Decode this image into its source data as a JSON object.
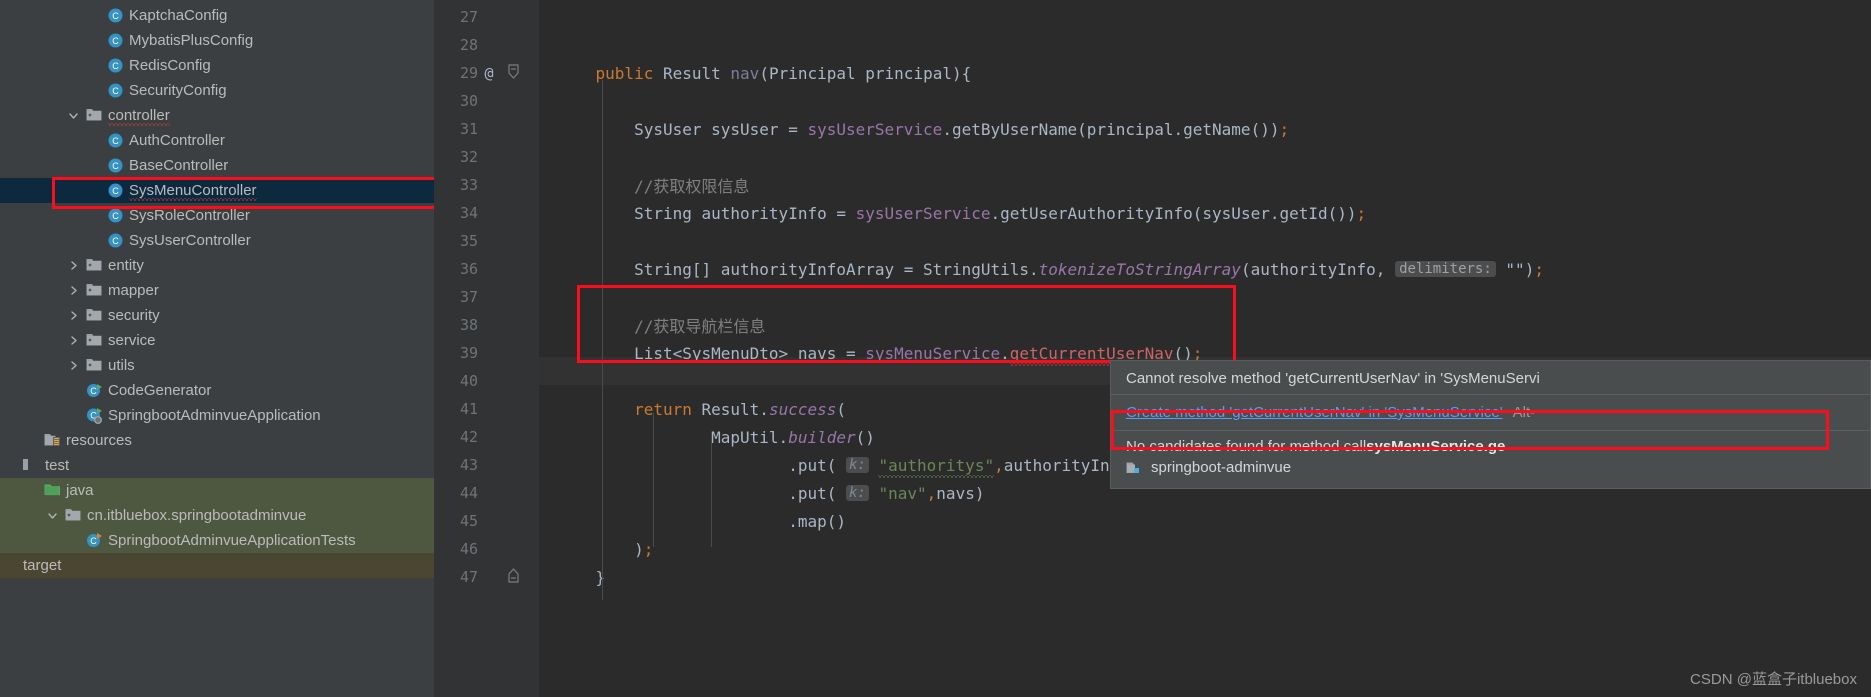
{
  "window": {
    "watermark": "CSDN @蓝盒子itbluebox"
  },
  "colors": {
    "accent_red": "#fc0d1b",
    "link_blue": "#589df6",
    "selection_blue": "#0d293e",
    "tree_bg": "#3c3f41",
    "editor_bg": "#2b2b2b",
    "gutter_bg": "#313335",
    "popup_bg": "#4a4d4e",
    "error_red": "#cc6666",
    "keyword_orange": "#cc7832",
    "string_green": "#6a8759",
    "method_purple": "#9876aa"
  },
  "project_tree": {
    "items": [
      {
        "label": "KaptchaConfig",
        "icon": "java-class-icon",
        "indent": 4,
        "arrow": "none",
        "state": "normal",
        "squiggle": false
      },
      {
        "label": "MybatisPlusConfig",
        "icon": "java-class-icon",
        "indent": 4,
        "arrow": "none",
        "state": "normal",
        "squiggle": false
      },
      {
        "label": "RedisConfig",
        "icon": "java-class-icon",
        "indent": 4,
        "arrow": "none",
        "state": "normal",
        "squiggle": false
      },
      {
        "label": "SecurityConfig",
        "icon": "java-class-icon",
        "indent": 4,
        "arrow": "none",
        "state": "normal",
        "squiggle": false
      },
      {
        "label": "controller",
        "icon": "folder-icon",
        "indent": 3,
        "arrow": "expanded",
        "state": "normal",
        "squiggle": true
      },
      {
        "label": "AuthController",
        "icon": "java-class-icon",
        "indent": 4,
        "arrow": "none",
        "state": "normal",
        "squiggle": false
      },
      {
        "label": "BaseController",
        "icon": "java-class-icon",
        "indent": 4,
        "arrow": "none",
        "state": "normal",
        "squiggle": false
      },
      {
        "label": "SysMenuController",
        "icon": "java-class-icon",
        "indent": 4,
        "arrow": "none",
        "state": "selected",
        "squiggle": true
      },
      {
        "label": "SysRoleController",
        "icon": "java-class-icon",
        "indent": 4,
        "arrow": "none",
        "state": "normal",
        "squiggle": false
      },
      {
        "label": "SysUserController",
        "icon": "java-class-icon",
        "indent": 4,
        "arrow": "none",
        "state": "normal",
        "squiggle": false
      },
      {
        "label": "entity",
        "icon": "folder-icon",
        "indent": 3,
        "arrow": "collapsed",
        "state": "normal",
        "squiggle": false
      },
      {
        "label": "mapper",
        "icon": "folder-icon",
        "indent": 3,
        "arrow": "collapsed",
        "state": "normal",
        "squiggle": false
      },
      {
        "label": "security",
        "icon": "folder-icon",
        "indent": 3,
        "arrow": "collapsed",
        "state": "normal",
        "squiggle": false
      },
      {
        "label": "service",
        "icon": "folder-icon",
        "indent": 3,
        "arrow": "collapsed",
        "state": "normal",
        "squiggle": false
      },
      {
        "label": "utils",
        "icon": "folder-icon",
        "indent": 3,
        "arrow": "collapsed",
        "state": "normal",
        "squiggle": false
      },
      {
        "label": "CodeGenerator",
        "icon": "java-runnable-class-icon",
        "indent": 3,
        "arrow": "none",
        "state": "normal",
        "squiggle": false
      },
      {
        "label": "SpringbootAdminvueApplication",
        "icon": "spring-boot-class-icon",
        "indent": 3,
        "arrow": "none",
        "state": "normal",
        "squiggle": false
      },
      {
        "label": "resources",
        "icon": "resources-folder-icon",
        "indent": 1,
        "arrow": "none",
        "state": "normal",
        "squiggle": false
      },
      {
        "label": "test",
        "icon": "module-bar-icon",
        "indent": 0,
        "arrow": "none",
        "state": "normal",
        "squiggle": false
      },
      {
        "label": "java",
        "icon": "test-source-folder-icon",
        "indent": 1,
        "arrow": "none",
        "state": "green",
        "squiggle": false
      },
      {
        "label": "cn.itbluebox.springbootadminvue",
        "icon": "folder-icon",
        "indent": 2,
        "arrow": "expanded",
        "state": "green",
        "squiggle": false
      },
      {
        "label": "SpringbootAdminvueApplicationTests",
        "icon": "java-test-class-icon",
        "indent": 3,
        "arrow": "none",
        "state": "green",
        "squiggle": false
      },
      {
        "label": "target",
        "icon": "none",
        "indent": 0,
        "arrow": "none",
        "state": "olive",
        "squiggle": false
      }
    ]
  },
  "editor": {
    "gutter": {
      "line_numbers": [
        "27",
        "28",
        "29",
        "30",
        "31",
        "32",
        "33",
        "34",
        "35",
        "36",
        "37",
        "38",
        "39",
        "40",
        "41",
        "42",
        "43",
        "44",
        "45",
        "46",
        "47"
      ],
      "annotation_at_line": "29",
      "annotation_glyph": "@",
      "fold_open_line": "29",
      "fold_close_line": "47",
      "caret_line": "40"
    },
    "lines": [
      {
        "num": "27",
        "tokens": []
      },
      {
        "num": "28",
        "tokens": []
      },
      {
        "num": "29",
        "tokens": [
          {
            "t": "    ",
            "c": "plain"
          },
          {
            "t": "public ",
            "c": "kw"
          },
          {
            "t": "Result ",
            "c": "typ"
          },
          {
            "t": "nav",
            "c": "meth"
          },
          {
            "t": "(Principal principal){",
            "c": "plain"
          }
        ]
      },
      {
        "num": "30",
        "tokens": []
      },
      {
        "num": "31",
        "tokens": [
          {
            "t": "        SysUser sysUser = ",
            "c": "plain"
          },
          {
            "t": "sysUserService",
            "c": "methi"
          },
          {
            "t": ".getByUserName(principal.getName())",
            "c": "plain"
          },
          {
            "t": ";",
            "c": "semi"
          }
        ]
      },
      {
        "num": "32",
        "tokens": []
      },
      {
        "num": "33",
        "tokens": [
          {
            "t": "        //获取权限信息",
            "c": "cmt"
          }
        ]
      },
      {
        "num": "34",
        "tokens": [
          {
            "t": "        String authorityInfo = ",
            "c": "plain"
          },
          {
            "t": "sysUserService",
            "c": "methi"
          },
          {
            "t": ".getUserAuthorityInfo(sysUser.getId())",
            "c": "plain"
          },
          {
            "t": ";",
            "c": "semi"
          }
        ]
      },
      {
        "num": "35",
        "tokens": []
      },
      {
        "num": "36",
        "tokens": [
          {
            "t": "        String[] authorityInfoArray = StringUtils.",
            "c": "plain"
          },
          {
            "t": "tokenizeToStringArray",
            "c": "fnitalic"
          },
          {
            "t": "(authorityInfo, ",
            "c": "plain"
          },
          {
            "t": "delimiters:",
            "c": "hint"
          },
          {
            "t": " \"\"",
            "c": "plain"
          },
          {
            "t": ")",
            "c": "plain"
          },
          {
            "t": ";",
            "c": "semi"
          }
        ]
      },
      {
        "num": "37",
        "tokens": []
      },
      {
        "num": "38",
        "tokens": [
          {
            "t": "        //获取导航栏信息",
            "c": "cmt"
          }
        ]
      },
      {
        "num": "39",
        "tokens": [
          {
            "t": "        List<SysMenuDto> navs = ",
            "c": "plain"
          },
          {
            "t": "sysMenuService",
            "c": "methi"
          },
          {
            "t": ".",
            "c": "plain"
          },
          {
            "t": "getCurrentUserNav",
            "c": "err"
          },
          {
            "t": "()",
            "c": "plain"
          },
          {
            "t": ";",
            "c": "semi"
          }
        ]
      },
      {
        "num": "40",
        "tokens": []
      },
      {
        "num": "41",
        "tokens": [
          {
            "t": "        ",
            "c": "plain"
          },
          {
            "t": "return ",
            "c": "kw"
          },
          {
            "t": "Result.",
            "c": "plain"
          },
          {
            "t": "success",
            "c": "fnitalic"
          },
          {
            "t": "(",
            "c": "plain"
          }
        ]
      },
      {
        "num": "42",
        "tokens": [
          {
            "t": "                MapUtil.",
            "c": "plain"
          },
          {
            "t": "builder",
            "c": "fnitalic"
          },
          {
            "t": "()",
            "c": "plain"
          }
        ]
      },
      {
        "num": "43",
        "tokens": [
          {
            "t": "                        .put( ",
            "c": "plain"
          },
          {
            "t": "k:",
            "c": "hintk"
          },
          {
            "t": " ",
            "c": "plain"
          },
          {
            "t": "\"authoritys\"",
            "c": "strsquig"
          },
          {
            "t": ",",
            "c": "semi"
          },
          {
            "t": "authorityInfoArray)",
            "c": "plain"
          }
        ]
      },
      {
        "num": "44",
        "tokens": [
          {
            "t": "                        .put( ",
            "c": "plain"
          },
          {
            "t": "k:",
            "c": "hintk"
          },
          {
            "t": " ",
            "c": "plain"
          },
          {
            "t": "\"nav\"",
            "c": "str"
          },
          {
            "t": ",",
            "c": "semi"
          },
          {
            "t": "navs)",
            "c": "plain"
          }
        ]
      },
      {
        "num": "45",
        "tokens": [
          {
            "t": "                        .map()",
            "c": "plain"
          }
        ]
      },
      {
        "num": "46",
        "tokens": [
          {
            "t": "        )",
            "c": "plain"
          },
          {
            "t": ";",
            "c": "semi"
          }
        ]
      },
      {
        "num": "47",
        "tokens": [
          {
            "t": "    }",
            "c": "plain"
          }
        ]
      }
    ]
  },
  "tooltip_popup": {
    "error_message": "Cannot resolve method 'getCurrentUserNav' in 'SysMenuServi",
    "quickfix_label": "Create method 'getCurrentUserNav' in 'SysMenuService'",
    "quickfix_shortcut": "Alt-",
    "no_candidates_prefix": "No candidates found for method call ",
    "no_candidates_bold": "sysMenuService.ge",
    "module_name": "springboot-adminvue",
    "module_icon": "module-folder-icon"
  },
  "annotations": {
    "highlight_boxes": [
      {
        "name": "sysmenucontroller-highlight"
      },
      {
        "name": "navs-line-highlight"
      },
      {
        "name": "create-method-quickfix-highlight"
      }
    ]
  }
}
